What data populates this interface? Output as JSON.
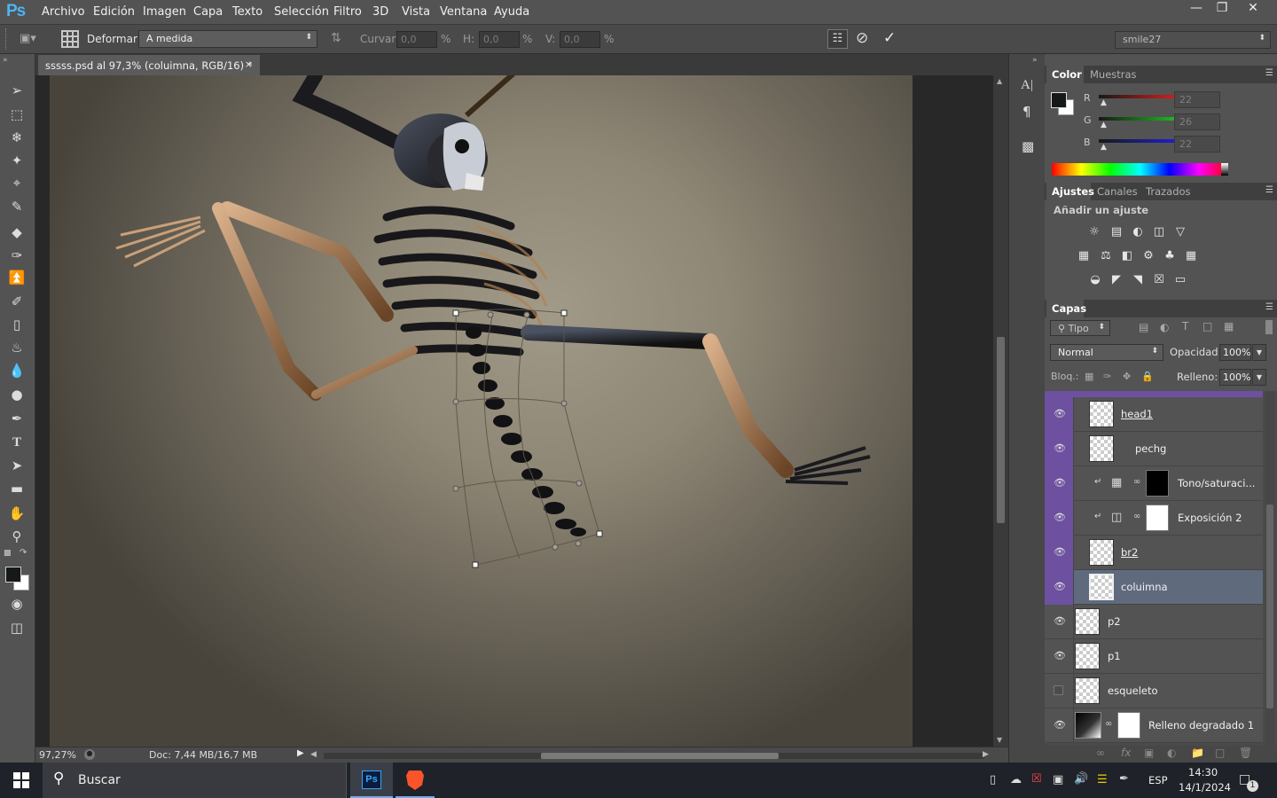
{
  "app": {
    "logo": "Ps",
    "menu": [
      "Archivo",
      "Edición",
      "Imagen",
      "Capa",
      "Texto",
      "Selección",
      "Filtro",
      "3D",
      "Vista",
      "Ventana",
      "Ayuda"
    ]
  },
  "options": {
    "warp_label": "Deformar:",
    "warp_value": "A medida",
    "bend_label": "Curvar:",
    "bend_value": "0,0",
    "h_label": "H:",
    "h_value": "0,0",
    "v_label": "V:",
    "v_value": "0,0",
    "pct": "%",
    "workspace": "smile27"
  },
  "document": {
    "tab_title": "sssss.psd al 97,3% (coluimna, RGB/16) *",
    "zoom": "97,27%",
    "doc_size": "Doc: 7,44 MB/16,7 MB"
  },
  "color_panel": {
    "tabs": [
      "Color",
      "Muestras"
    ],
    "r_label": "R",
    "g_label": "G",
    "b_label": "B",
    "r": "22",
    "g": "26",
    "b": "22"
  },
  "adjust_panel": {
    "tabs": [
      "Ajustes",
      "Canales",
      "Trazados"
    ],
    "title": "Añadir un ajuste"
  },
  "layers_panel": {
    "tab": "Capas",
    "filter": "Tipo",
    "blend_mode": "Normal",
    "opacity_label": "Opacidad:",
    "opacity": "100%",
    "lock_label": "Bloq.:",
    "fill_label": "Relleno:",
    "fill": "100%",
    "layers": [
      {
        "name": "head1",
        "visible": true,
        "group_color": "#6d50a0"
      },
      {
        "name": "pechg",
        "visible": true,
        "group_color": "#6d50a0"
      },
      {
        "name": "Tono/saturaci...",
        "visible": true,
        "group_color": "#6d50a0",
        "mask": "black"
      },
      {
        "name": "Exposición 2",
        "visible": true,
        "group_color": "#6d50a0",
        "mask": "white"
      },
      {
        "name": "br2",
        "visible": true,
        "group_color": "#6d50a0"
      },
      {
        "name": "coluimna",
        "visible": true,
        "group_color": "#6d50a0",
        "selected": true
      },
      {
        "name": "p2",
        "visible": true
      },
      {
        "name": "p1",
        "visible": true
      },
      {
        "name": "esqueleto",
        "visible": false
      },
      {
        "name": "Relleno degradado 1",
        "visible": true,
        "mask": "white"
      }
    ]
  },
  "taskbar": {
    "search_placeholder": "Buscar",
    "ps_label": "Ps",
    "language": "ESP",
    "time": "14:30",
    "date": "14/1/2024",
    "notifications": "1"
  }
}
